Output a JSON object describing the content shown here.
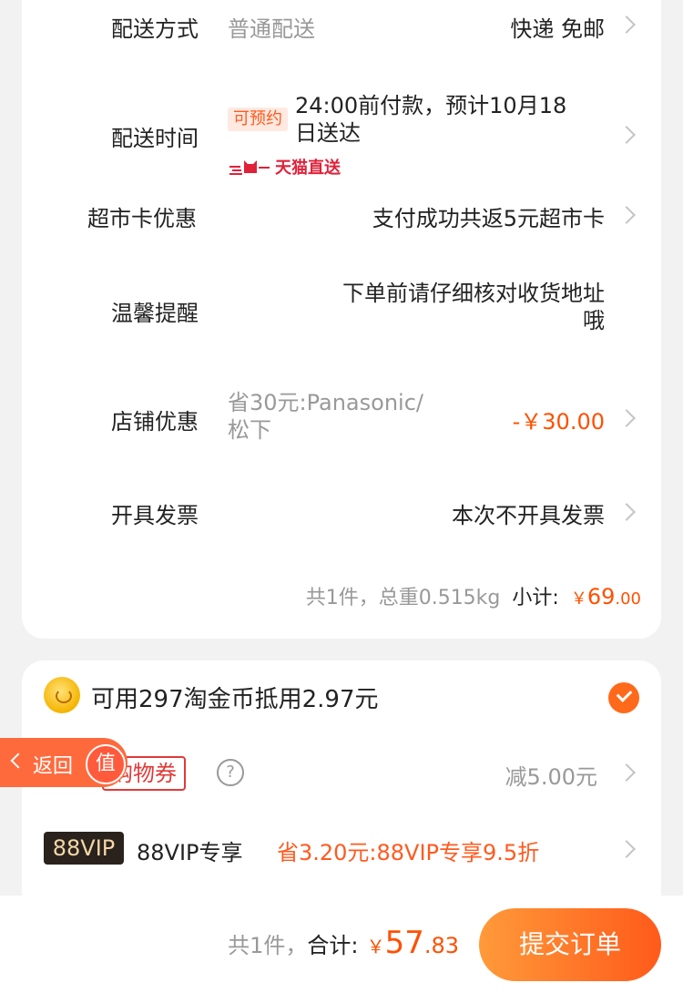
{
  "delivery": {
    "method_label": "配送方式",
    "method_value": "普通配送",
    "method_right": "快递 免邮",
    "time_label": "配送时间",
    "tag": "可预约",
    "time_value_line1": "24:00前付款，预计10月18",
    "time_value_line2": "日送达",
    "brand": "天猫直送"
  },
  "supermarket": {
    "label": "超市卡优惠",
    "value": "支付成功共返5元超市卡"
  },
  "reminder": {
    "label": "温馨提醒",
    "value_line1": "下单前请仔细核对收货地址",
    "value_line2": "哦"
  },
  "shop_discount": {
    "label": "店铺优惠",
    "desc_line1": "省30元:Panasonic/",
    "desc_line2": "松下",
    "amount": "-￥30.00"
  },
  "invoice": {
    "label": "开具发票",
    "value": "本次不开具发票"
  },
  "subtotal": {
    "summary": "共1件，总重0.515kg",
    "label": "小计:",
    "currency": "￥",
    "int": "69",
    "dec": ".00"
  },
  "coins": {
    "text": "可用297淘金币抵用2.97元"
  },
  "coupon": {
    "label": "购物券",
    "value": "减5.00元"
  },
  "back": {
    "label": "返回",
    "zhi": "值"
  },
  "vip": {
    "badge": "88VIP",
    "label": "88VIP专享",
    "value": "省3.20元:88VIP专享9.5折"
  },
  "footer": {
    "count": "共1件，",
    "total_label": "合计:",
    "currency": "￥",
    "int": "57",
    "dec": ".83",
    "submit": "提交订单"
  },
  "colors": {
    "accent": "#ff5000",
    "button_start": "#ff9a3a",
    "button_end": "#ff5a1a"
  }
}
